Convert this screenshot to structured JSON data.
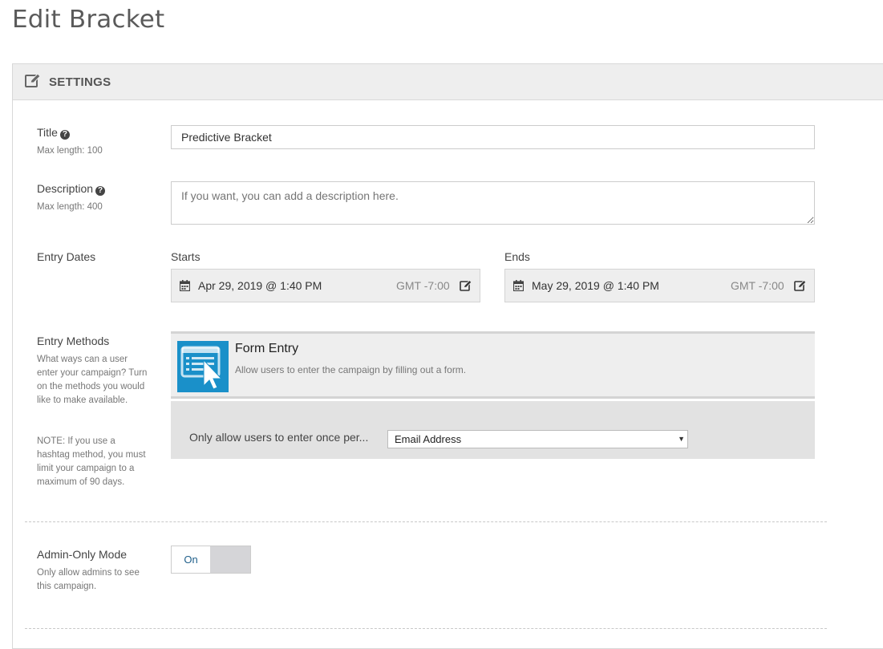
{
  "page": {
    "title": "Edit Bracket"
  },
  "panel": {
    "header": "SETTINGS"
  },
  "title_field": {
    "label": "Title",
    "hint": "Max length: 100",
    "value": "Predictive Bracket"
  },
  "description_field": {
    "label": "Description",
    "hint": "Max length: 400",
    "placeholder": "If you want, you can add a description here."
  },
  "entry_dates": {
    "label": "Entry Dates",
    "starts": {
      "label": "Starts",
      "value": "Apr 29, 2019 @ 1:40 PM",
      "tz": "GMT -7:00"
    },
    "ends": {
      "label": "Ends",
      "value": "May 29, 2019 @ 1:40 PM",
      "tz": "GMT -7:00"
    }
  },
  "entry_methods": {
    "label": "Entry Methods",
    "hint": "What ways can a user enter your campaign? Turn on the methods you would like to make available.",
    "note": "NOTE: If you use a hashtag method, you must limit your campaign to a maximum of 90 days.",
    "method": {
      "title": "Form Entry",
      "description": "Allow users to enter the campaign by filling out a form.",
      "icon": "form-cursor-icon",
      "once_per_label": "Only allow users to enter once per...",
      "once_per_value": "Email Address"
    }
  },
  "admin_mode": {
    "label": "Admin-Only Mode",
    "hint": "Only allow admins to see this campaign.",
    "toggle_label": "On"
  },
  "colors": {
    "accent": "#1a90c9",
    "header_bg": "#eeeeee",
    "toggle_text": "#1f5f8a"
  }
}
